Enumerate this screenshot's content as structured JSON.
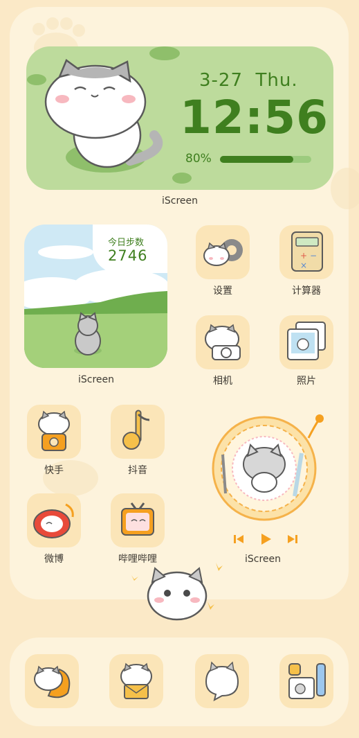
{
  "clock_widget": {
    "date": "3-27",
    "weekday": "Thu.",
    "time": "12:56",
    "battery_text": "80%",
    "battery_level": 0.8,
    "caption": "iScreen"
  },
  "steps_widget": {
    "label": "今日步数",
    "value": "2746",
    "caption": "iScreen"
  },
  "apps": {
    "settings": "设置",
    "calculator": "计算器",
    "camera": "相机",
    "photos": "照片",
    "kuaishou": "快手",
    "douyin": "抖音",
    "weibo": "微博",
    "bilibili": "哔哩哔哩"
  },
  "music_widget": {
    "caption": "iScreen",
    "controls": [
      "prev-icon",
      "play-icon",
      "next-icon"
    ]
  },
  "dock": {
    "icons": [
      "phone-cat-icon",
      "mail-cat-icon",
      "message-cat-icon",
      "widget-grid-icon"
    ]
  },
  "colors": {
    "background": "#fbe9c7",
    "panel": "#fdf3dc",
    "clock_green": "#bddb9c",
    "text_green": "#3f7f1f",
    "tile": "#fbe5b8",
    "accent_orange": "#f5a020"
  }
}
